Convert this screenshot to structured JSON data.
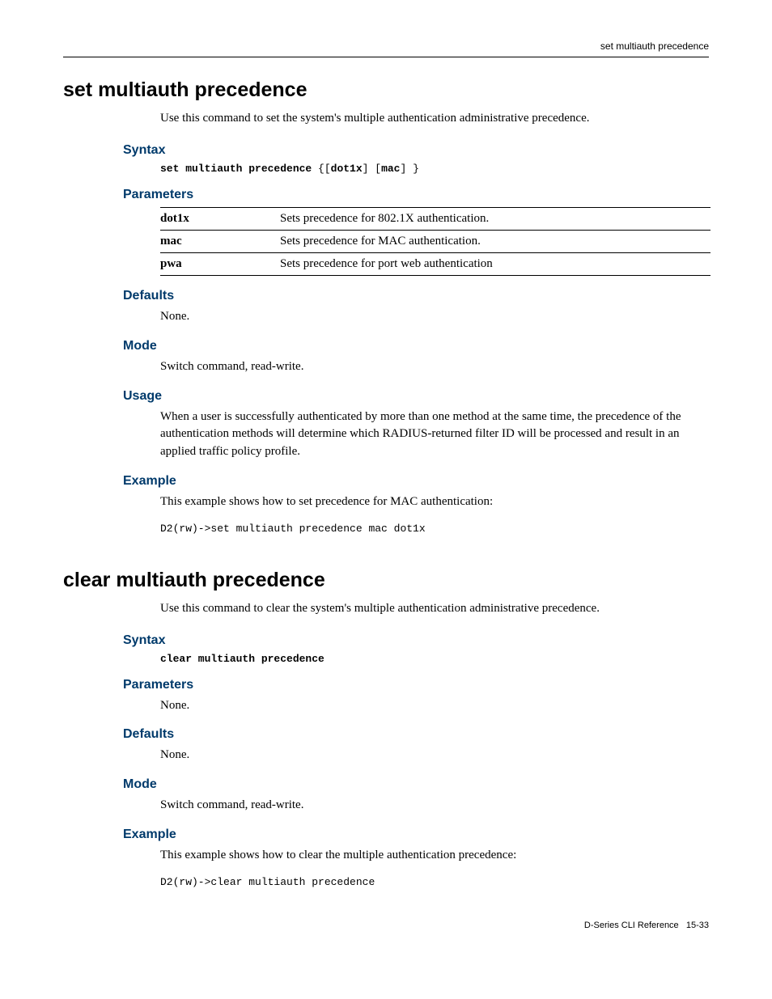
{
  "header": {
    "running_title": "set multiauth precedence"
  },
  "sections": [
    {
      "title": "set multiauth precedence",
      "intro": "Use this command to set the system's multiple authentication administrative precedence.",
      "syntax_cmd": "set multiauth precedence",
      "syntax_args": " {[dot1x] [mac] }",
      "syntax_arg1": "dot1x",
      "syntax_arg2": "mac",
      "params_rows": [
        {
          "name": "dot1x",
          "desc": "Sets precedence for 802.1X authentication."
        },
        {
          "name": "mac",
          "desc": "Sets precedence for MAC authentication."
        },
        {
          "name": "pwa",
          "desc": "Sets precedence for port web authentication"
        }
      ],
      "defaults": "None.",
      "mode": "Switch command, read-write.",
      "usage": "When a user is successfully authenticated by more than one method at the same time, the precedence of the authentication methods will determine which RADIUS-returned filter ID will be processed and result in an applied traffic policy profile.",
      "example_intro": "This example shows how to set precedence for MAC authentication:",
      "example_code": "D2(rw)->set multiauth precedence mac dot1x"
    },
    {
      "title": "clear multiauth precedence",
      "intro": "Use this command to clear the system's multiple authentication administrative precedence.",
      "syntax_cmd": "clear multiauth precedence",
      "params_none": "None.",
      "defaults": "None.",
      "mode": "Switch command, read-write.",
      "example_intro": "This example shows how to clear the multiple authentication precedence:",
      "example_code": "D2(rw)->clear multiauth precedence"
    }
  ],
  "labels": {
    "syntax": "Syntax",
    "parameters": "Parameters",
    "defaults": "Defaults",
    "mode": "Mode",
    "usage": "Usage",
    "example": "Example"
  },
  "footer": {
    "doc": "D-Series CLI Reference",
    "page": "15-33"
  }
}
